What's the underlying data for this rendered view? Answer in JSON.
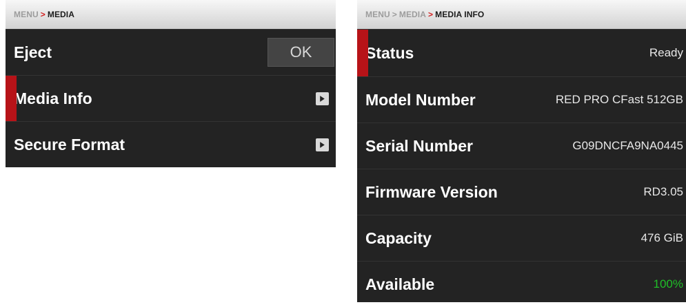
{
  "left": {
    "breadcrumb": {
      "root": "MENU",
      "sep": ">",
      "current": "MEDIA"
    },
    "rows": [
      {
        "label": "Eject",
        "button": "OK"
      },
      {
        "label": "Media Info",
        "icon": "chevron-right-icon"
      },
      {
        "label": "Secure Format",
        "icon": "chevron-right-icon"
      }
    ]
  },
  "right": {
    "breadcrumb": {
      "root": "MENU",
      "sep1": ">",
      "mid": "MEDIA",
      "sep2": ">",
      "current": "MEDIA INFO"
    },
    "rows": [
      {
        "label": "Status",
        "value": "Ready"
      },
      {
        "label": "Model Number",
        "value": "RED PRO CFast 512GB"
      },
      {
        "label": "Serial Number",
        "value": "G09DNCFA9NA0445"
      },
      {
        "label": "Firmware Version",
        "value": "RD3.05"
      },
      {
        "label": "Capacity",
        "value": "476 GiB"
      },
      {
        "label": "Available",
        "value": "100%"
      }
    ]
  },
  "colors": {
    "accent": "#b71318",
    "available": "#1fbf27"
  }
}
